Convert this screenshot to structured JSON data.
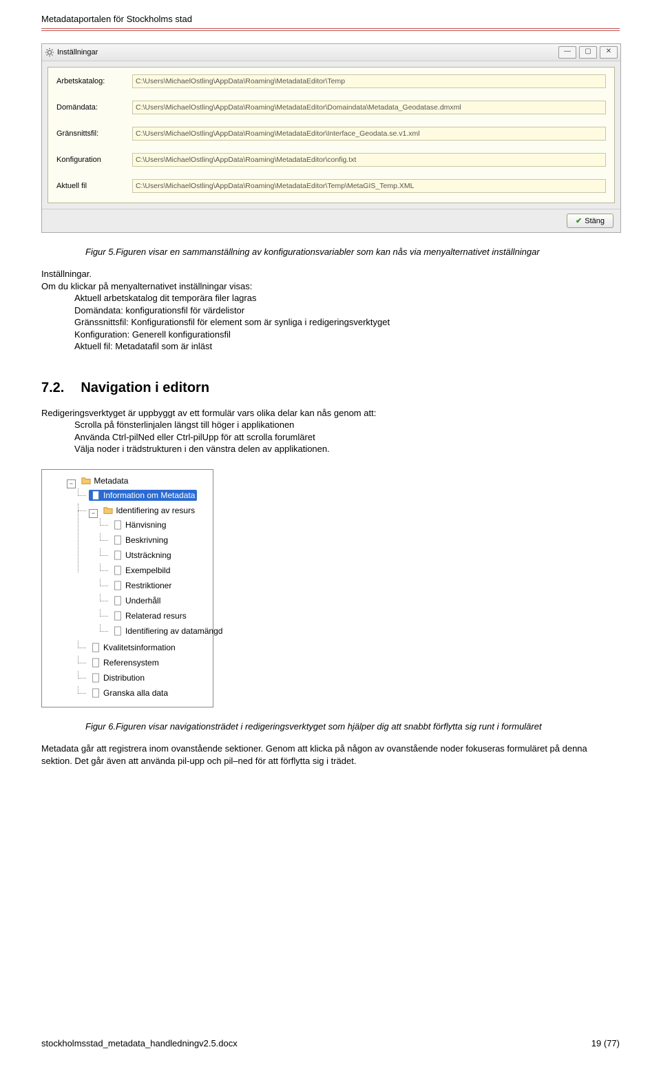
{
  "header": {
    "title": "Metadataportalen för Stockholms stad"
  },
  "settings_window": {
    "title": "Inställningar",
    "win_buttons": {
      "min": "—",
      "max": "▢",
      "close": "✕"
    },
    "rows": [
      {
        "label": "Arbetskatalog:",
        "value": "C:\\Users\\MichaelOstling\\AppData\\Roaming\\MetadataEditor\\Temp"
      },
      {
        "label": "Domändata:",
        "value": "C:\\Users\\MichaelOstling\\AppData\\Roaming\\MetadataEditor\\Domaindata\\Metadata_Geodatase.dmxml"
      },
      {
        "label": "Gränsnittsfil:",
        "value": "C:\\Users\\MichaelOstling\\AppData\\Roaming\\MetadataEditor\\Interface_Geodata.se.v1.xml"
      },
      {
        "label": "Konfiguration",
        "value": "C:\\Users\\MichaelOstling\\AppData\\Roaming\\MetadataEditor\\config.txt"
      },
      {
        "label": "Aktuell fil",
        "value": "C:\\Users\\MichaelOstling\\AppData\\Roaming\\MetadataEditor\\Temp\\MetaGIS_Temp.XML"
      }
    ],
    "close_button": "Stäng"
  },
  "figure5_caption": "Figur 5.Figuren visar en sammanställning av konfigurationsvariabler som kan nås via menyalternativet inställningar",
  "section_installningar": {
    "heading": "Inställningar.",
    "intro": "Om du klickar på menyalternativet inställningar visas:",
    "lines": [
      "Aktuell arbetskatalog dit temporära filer lagras",
      "Domändata: konfigurationsfil för  värdelistor",
      "Gränssnittsfil: Konfigurationsfil för element som är synliga i redigeringsverktyget",
      "Konfiguration: Generell konfigurationsfil",
      "Aktuell fil: Metadatafil som är inläst"
    ]
  },
  "h2": {
    "number": "7.2.",
    "title": "Navigation i editorn"
  },
  "nav_paragraph": {
    "intro": "Redigeringsverktyget är uppbyggt av ett formulär vars olika delar kan nås genom att:",
    "lines": [
      "Scrolla på fönsterlinjalen längst till höger i applikationen",
      "Använda Ctrl-pilNed eller Ctrl-pilUpp för att scrolla forumläret",
      "Välja noder i trädstrukturen i den vänstra delen av applikationen."
    ]
  },
  "tree": {
    "root": "Metadata",
    "selected": "Information om Metadata",
    "group": "Identifiering av resurs",
    "group_children": [
      "Hänvisning",
      "Beskrivning",
      "Utsträckning",
      "Exempelbild",
      "Restriktioner",
      "Underhåll",
      "Relaterad resurs",
      "Identifiering av datamängd"
    ],
    "siblings": [
      "Kvalitetsinformation",
      "Referensystem",
      "Distribution",
      "Granska alla data"
    ]
  },
  "figure6_caption": "Figur 6.Figuren visar navigationsträdet i redigeringsverktyget som hjälper dig att snabbt förflytta sig runt i formuläret",
  "closing_paragraph": "Metadata går att registrera inom ovanstående sektioner. Genom att klicka på någon av ovanstående noder fokuseras formuläret på denna sektion. Det går även att använda pil-upp och pil–ned för att förflytta sig i trädet.",
  "footer": {
    "filename": "stockholmsstad_metadata_handledningv2.5.docx",
    "page": "19 (77)"
  }
}
